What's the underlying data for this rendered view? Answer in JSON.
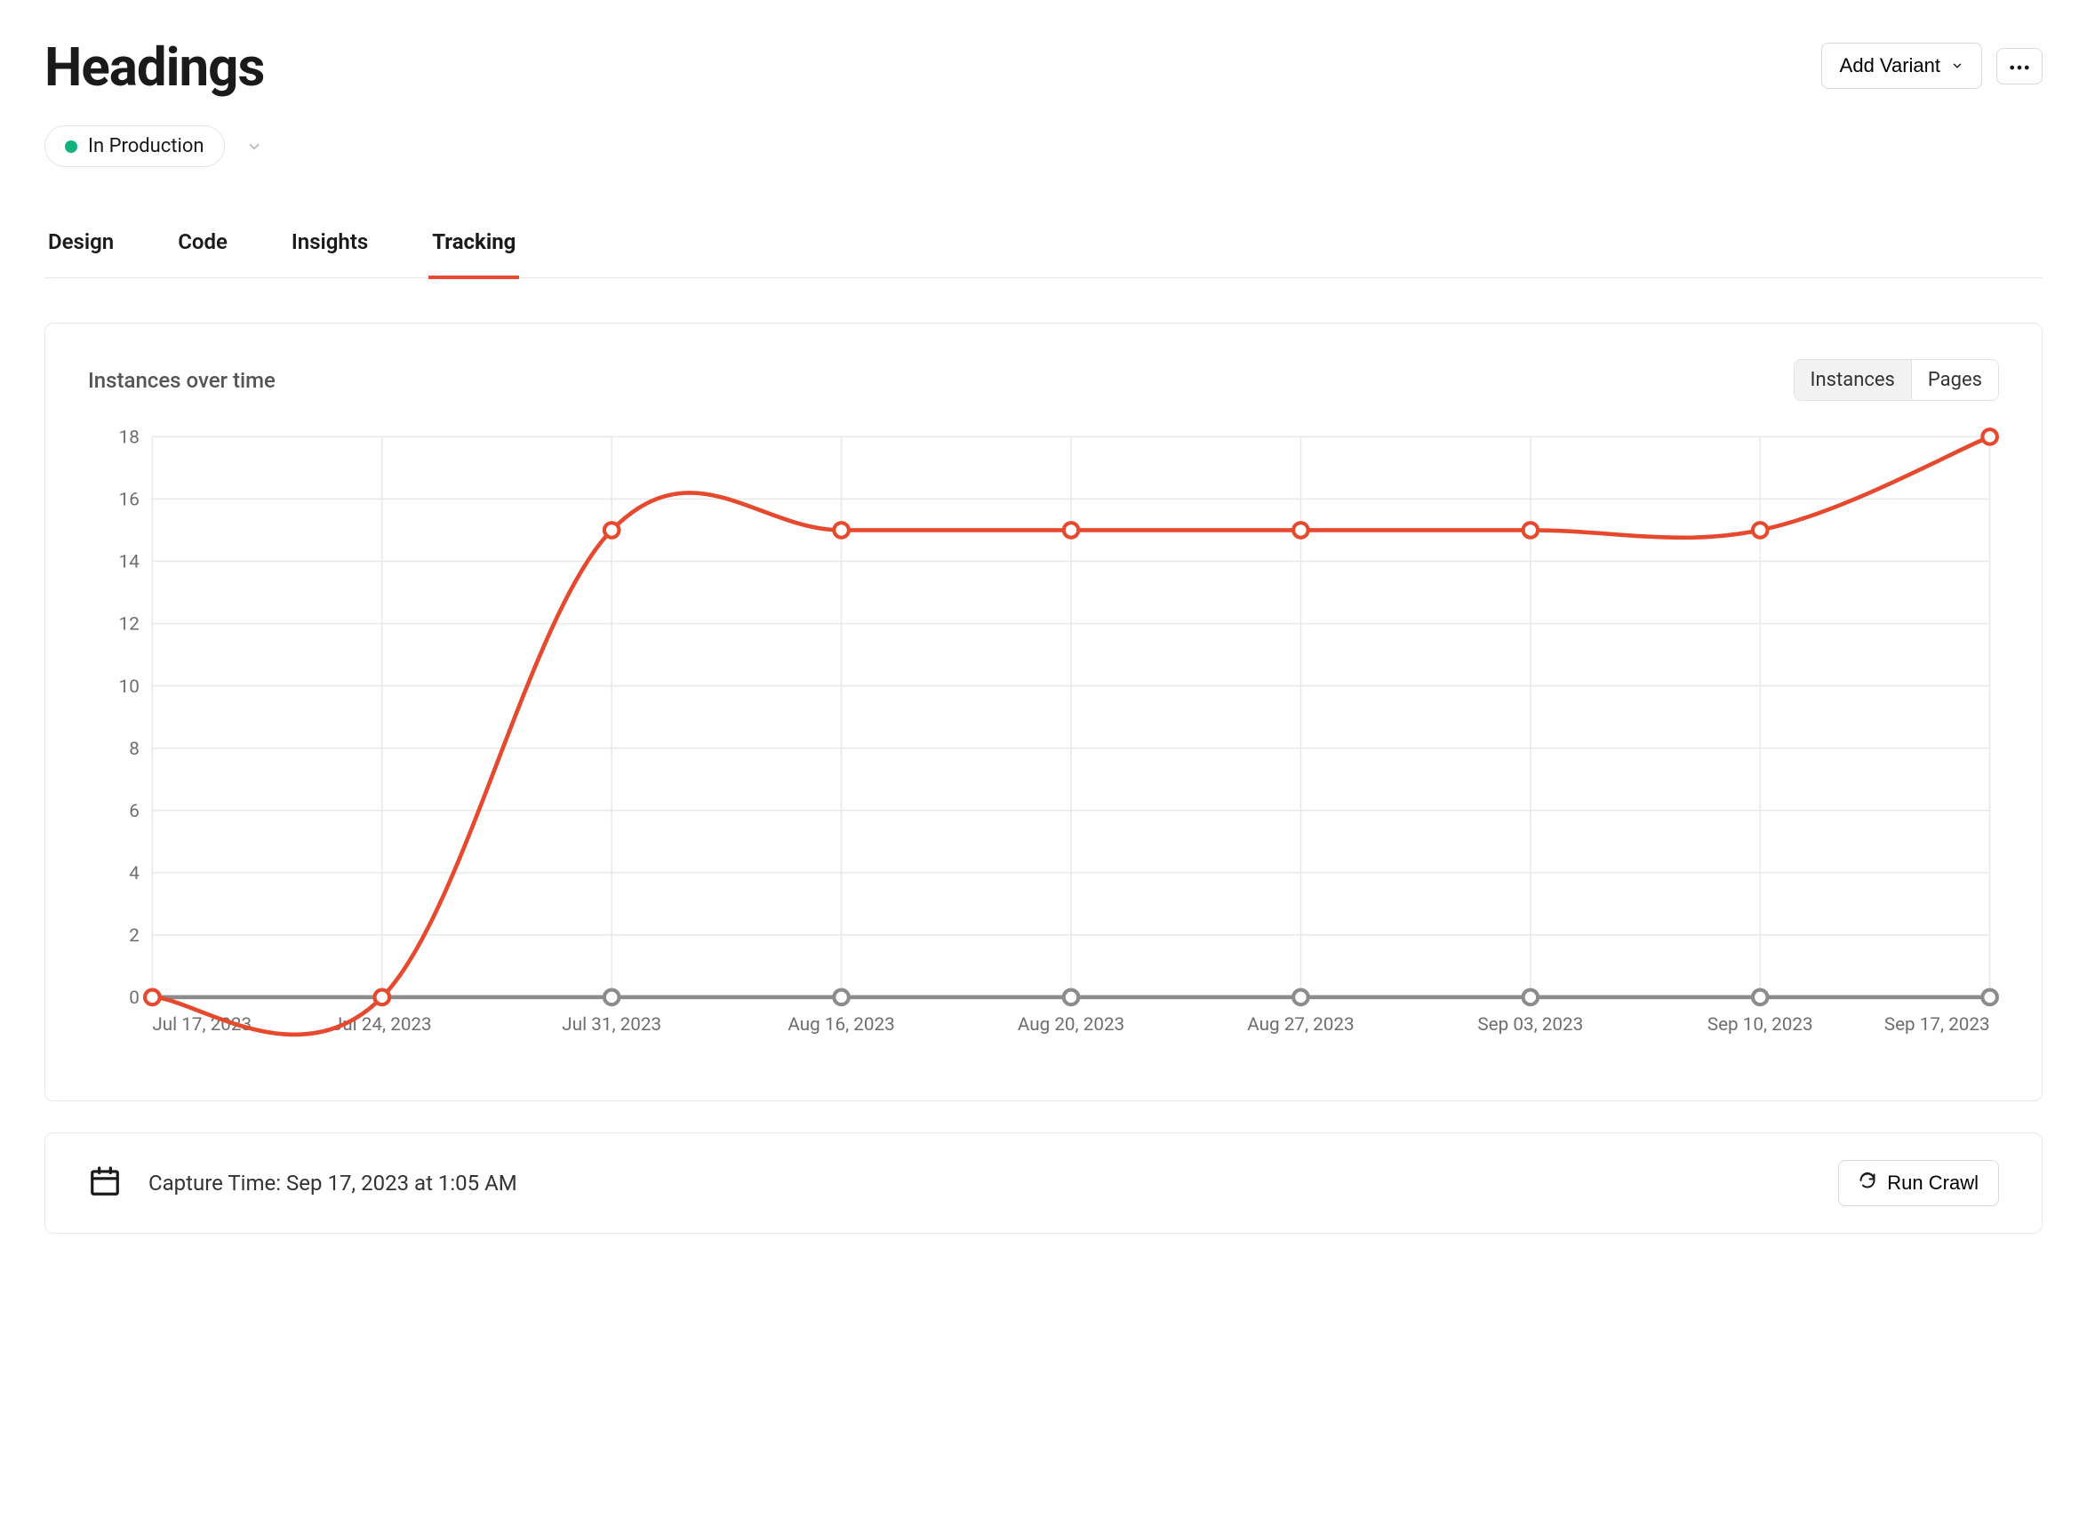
{
  "header": {
    "title": "Headings",
    "add_variant_label": "Add Variant"
  },
  "status": {
    "label": "In Production",
    "color": "#0fb37a"
  },
  "tabs": [
    {
      "label": "Design",
      "active": false
    },
    {
      "label": "Code",
      "active": false
    },
    {
      "label": "Insights",
      "active": false
    },
    {
      "label": "Tracking",
      "active": true
    }
  ],
  "chart_card": {
    "title": "Instances over time",
    "toggle": [
      {
        "label": "Instances",
        "active": true
      },
      {
        "label": "Pages",
        "active": false
      }
    ]
  },
  "chart_data": {
    "type": "line",
    "title": "Instances over time",
    "xlabel": "",
    "ylabel": "",
    "ylim": [
      0,
      18
    ],
    "y_ticks": [
      0,
      2,
      4,
      6,
      8,
      10,
      12,
      14,
      16,
      18
    ],
    "categories": [
      "Jul 17, 2023",
      "Jul 24, 2023",
      "Jul 31, 2023",
      "Aug 16, 2023",
      "Aug 20, 2023",
      "Aug 27, 2023",
      "Sep 03, 2023",
      "Sep 10, 2023",
      "Sep 17, 2023"
    ],
    "series": [
      {
        "name": "Instances",
        "color": "#e6492d",
        "values": [
          0,
          0,
          15,
          15,
          15,
          15,
          15,
          15,
          18
        ]
      },
      {
        "name": "Pages",
        "color": "#8c8c8c",
        "values": [
          0,
          0,
          0,
          0,
          0,
          0,
          0,
          0,
          0
        ]
      }
    ]
  },
  "capture": {
    "text": "Capture Time: Sep 17, 2023 at 1:05 AM",
    "run_crawl_label": "Run Crawl"
  }
}
